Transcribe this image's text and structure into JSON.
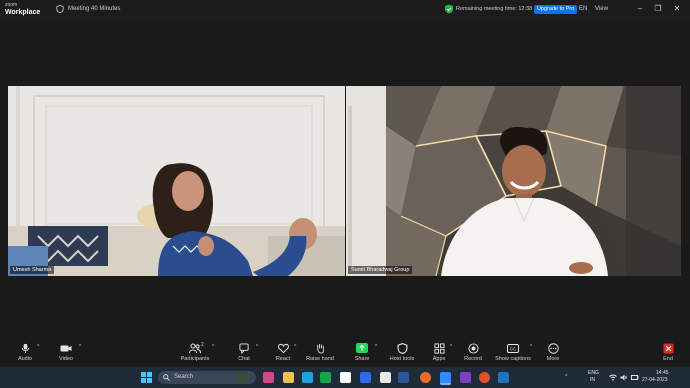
{
  "titlebar": {
    "logo_line1": "zoom",
    "logo_line2": "Workplace",
    "meeting_title": "Meeting 40 Minutes",
    "remaining_text": "Remaining meeting time: 12:38",
    "upgrade_label": "Upgrade to Pro",
    "language": "EN",
    "view_label": "View",
    "minimize": "–",
    "maximize": "❐",
    "close": "✕"
  },
  "participants": [
    {
      "name": "Umesh Sharma"
    },
    {
      "name": "Sumit Bharadwaj Group"
    }
  ],
  "toolbar": {
    "audio": "Audio",
    "video": "Video",
    "participants": "Participants",
    "participants_count": "2",
    "chat": "Chat",
    "react": "React",
    "raise_hand": "Raise hand",
    "share": "Share",
    "host_tools": "Host tools",
    "apps": "Apps",
    "record": "Record",
    "show_captions": "Show captions",
    "more": "More",
    "end": "End",
    "accent_share": "#23d959",
    "accent_end": "#e02828"
  },
  "taskbar": {
    "search_placeholder": "Search",
    "lang_line1": "ENG",
    "lang_line2": "IN",
    "time": "14:45",
    "date": "27-04-2023"
  }
}
